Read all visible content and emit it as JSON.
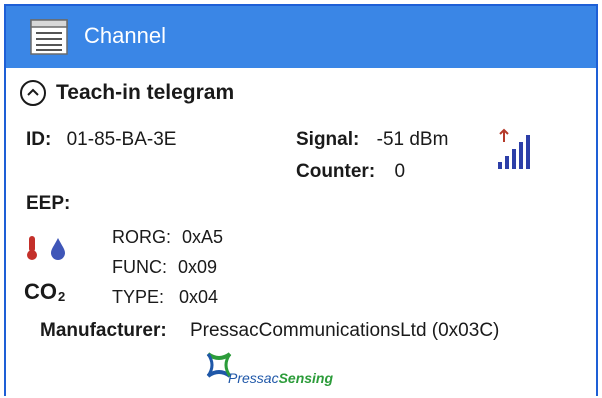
{
  "window": {
    "title": "Channel",
    "icon": "channel-list-icon",
    "accent_color": "#3a86e6"
  },
  "section": {
    "title": "Teach-in telegram",
    "toggle_icon": "chevron-up-icon"
  },
  "device": {
    "id_label": "ID:",
    "id_value": "01-85-BA-3E",
    "signal_label": "Signal:",
    "signal_value": "-51 dBm",
    "signal_icon": "signal-strength-icon",
    "counter_label": "Counter:",
    "counter_value": "0"
  },
  "eep": {
    "label": "EEP:",
    "icons": [
      "thermometer-icon",
      "humidity-drop-icon"
    ],
    "co2_text": "CO",
    "co2_sub": "2",
    "rorg_label": "RORG:",
    "rorg_value": "0xA5",
    "func_label": "FUNC:",
    "func_value": "0x09",
    "type_label": "TYPE:",
    "type_value": "0x04"
  },
  "manufacturer": {
    "label": "Manufacturer:",
    "value": "PressacCommunicationsLtd (0x03C)",
    "logo_text_a": "Pressac",
    "logo_text_b": "Sensing"
  }
}
